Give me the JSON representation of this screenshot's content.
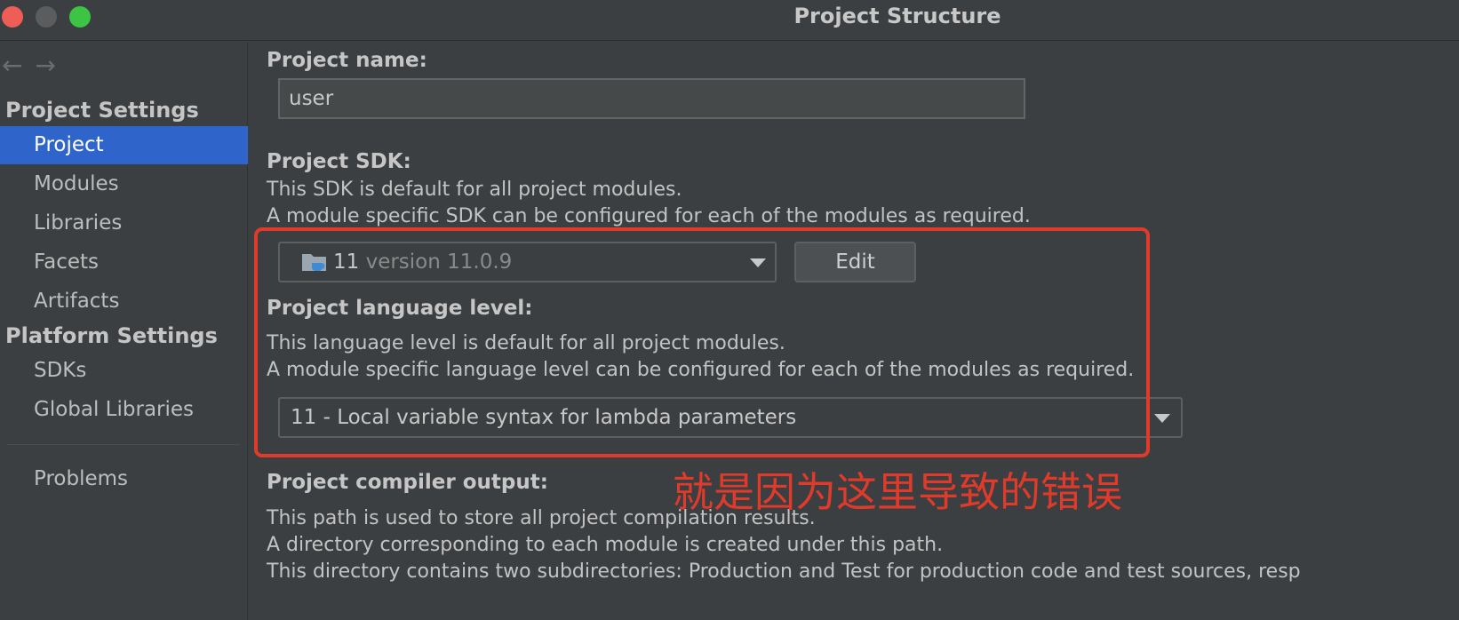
{
  "window": {
    "title": "Project Structure"
  },
  "sidebar": {
    "project_settings_header": "Project Settings",
    "platform_settings_header": "Platform Settings",
    "items": [
      {
        "label": "Project",
        "selected": true
      },
      {
        "label": "Modules"
      },
      {
        "label": "Libraries"
      },
      {
        "label": "Facets"
      },
      {
        "label": "Artifacts"
      },
      {
        "label": "SDKs"
      },
      {
        "label": "Global Libraries"
      },
      {
        "label": "Problems"
      }
    ]
  },
  "main": {
    "project_name_label": "Project name:",
    "project_name_value": "user",
    "sdk_label": "Project SDK:",
    "sdk_desc_1": "This SDK is default for all project modules.",
    "sdk_desc_2": "A module specific SDK can be configured for each of the modules as required.",
    "sdk_selected_name": "11",
    "sdk_selected_version": "version 11.0.9",
    "edit_button": "Edit",
    "lang_label": "Project language level:",
    "lang_desc_1": "This language level is default for all project modules.",
    "lang_desc_2": "A module specific language level can be configured for each of the modules as required.",
    "lang_selected": "11 - Local variable syntax for lambda parameters",
    "compiler_label": "Project compiler output:",
    "compiler_desc_1": "This path is used to store all project compilation results.",
    "compiler_desc_2": "A directory corresponding to each module is created under this path.",
    "compiler_desc_3": "This directory contains two subdirectories: Production and Test for production code and test sources, resp"
  },
  "annotation": {
    "text": "就是因为这里导致的错误",
    "color": "#e03a2a"
  },
  "colors": {
    "selection": "#2f65ca",
    "background": "#3c3f41"
  }
}
